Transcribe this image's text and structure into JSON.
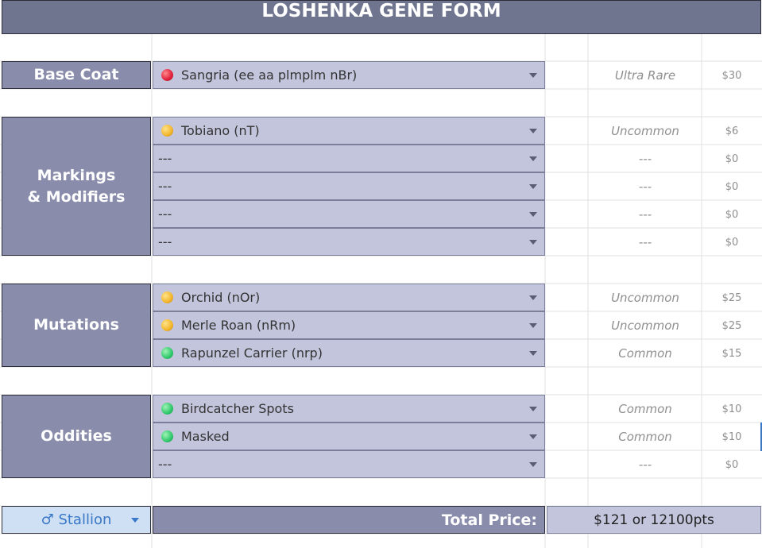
{
  "title": "LOSHENKA GENE FORM",
  "sections": {
    "base": "Base Coat",
    "markings_line1": "Markings",
    "markings_line2": "& Modifiers",
    "mutations": "Mutations",
    "oddities": "Oddities"
  },
  "rows": {
    "base": [
      {
        "option": "Sangria (ee aa plmplm nBr)",
        "dot": "red",
        "rarity": "Ultra Rare",
        "price": "$30"
      }
    ],
    "markings": [
      {
        "option": "Tobiano (nT)",
        "dot": "yellow",
        "rarity": "Uncommon",
        "price": "$6"
      },
      {
        "option": "---",
        "dot": "",
        "rarity": "---",
        "price": "$0"
      },
      {
        "option": "---",
        "dot": "",
        "rarity": "---",
        "price": "$0"
      },
      {
        "option": "---",
        "dot": "",
        "rarity": "---",
        "price": "$0"
      },
      {
        "option": "---",
        "dot": "",
        "rarity": "---",
        "price": "$0"
      }
    ],
    "mutations": [
      {
        "option": "Orchid (nOr)",
        "dot": "yellow",
        "rarity": "Uncommon",
        "price": "$25"
      },
      {
        "option": "Merle Roan (nRm)",
        "dot": "yellow",
        "rarity": "Uncommon",
        "price": "$25"
      },
      {
        "option": "Rapunzel Carrier (nrp)",
        "dot": "green",
        "rarity": "Common",
        "price": "$15"
      }
    ],
    "oddities": [
      {
        "option": "Birdcatcher Spots",
        "dot": "green",
        "rarity": "Common",
        "price": "$10"
      },
      {
        "option": "Masked",
        "dot": "green",
        "rarity": "Common",
        "price": "$10"
      },
      {
        "option": "---",
        "dot": "",
        "rarity": "---",
        "price": "$0"
      }
    ]
  },
  "gender": {
    "label": "♂ Stallion"
  },
  "total": {
    "label": "Total Price:",
    "value": "$121 or 12100pts"
  },
  "colors": {
    "header": "#6f748f",
    "section": "#898cab",
    "select": "#c2c5dc",
    "gender_bg": "#cfe0f4",
    "gender_text": "#3a78c8"
  }
}
